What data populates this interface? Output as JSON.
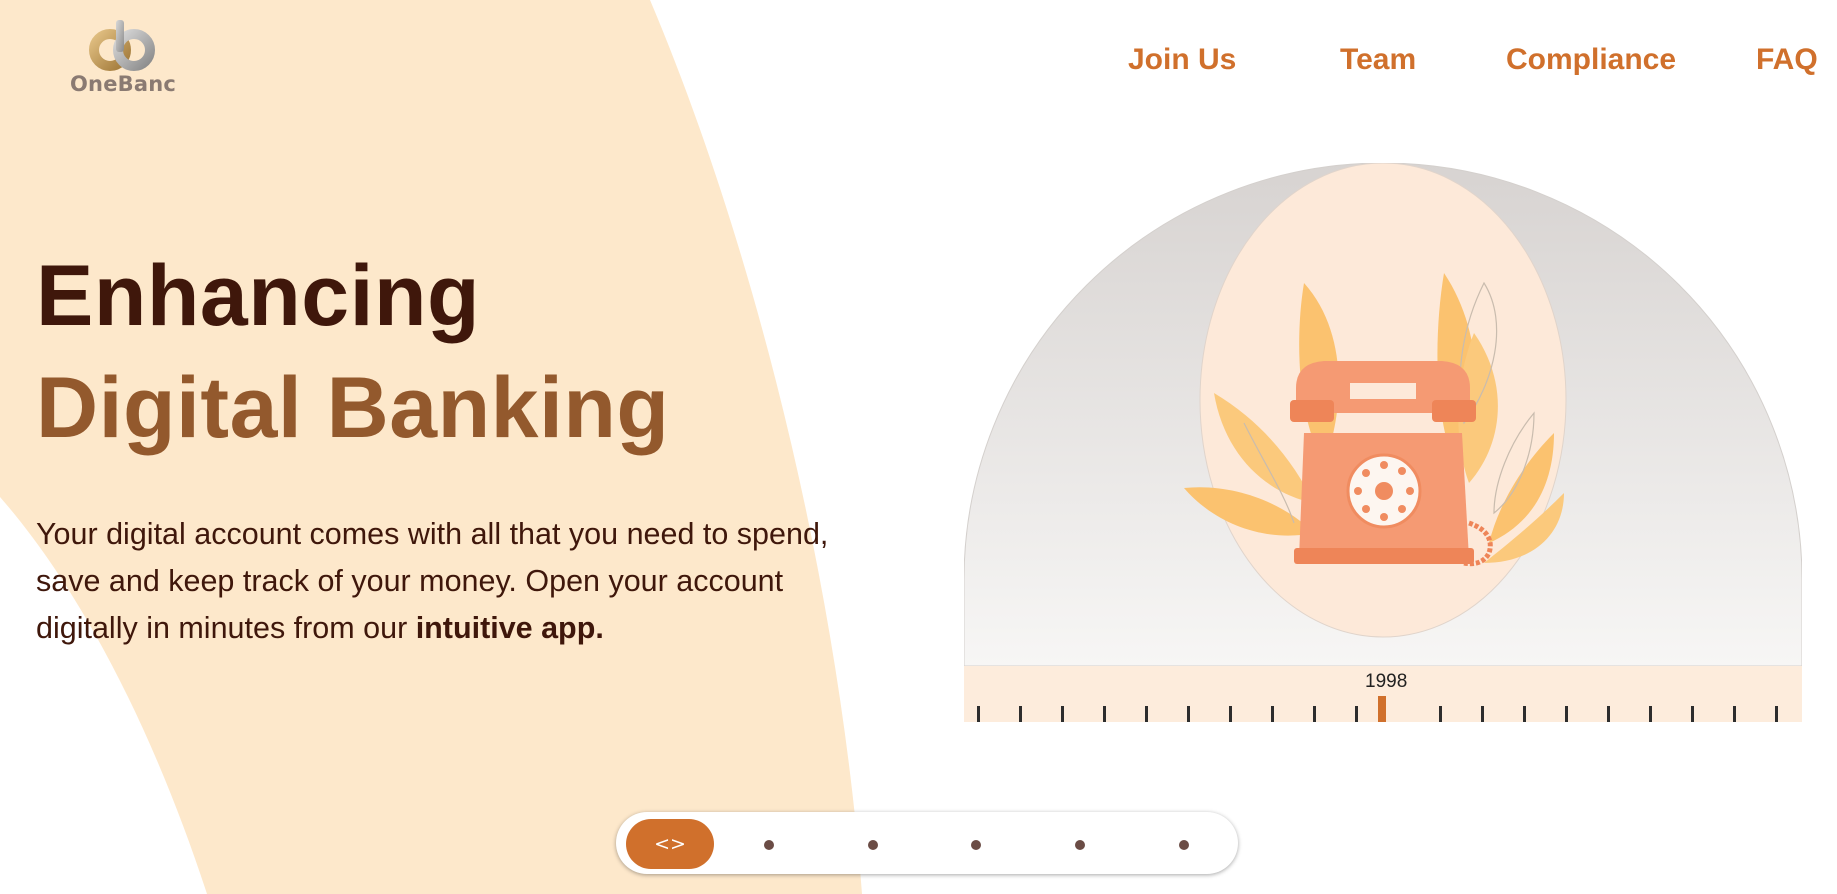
{
  "brand": {
    "name": "OneBanc",
    "logo_icon": "onebanc-logo-icon",
    "colors": {
      "accent": "#d0702c",
      "dark": "#3f170b",
      "brown": "#93592d",
      "cream": "#fde8cb"
    }
  },
  "nav": {
    "items": [
      "Join Us",
      "Team",
      "Compliance",
      "FAQ"
    ]
  },
  "hero": {
    "title_line1": "Enhancing",
    "title_line2": "Digital Banking",
    "description": "Your digital account comes with all that you need to spend, save and keep track of your money. Open your account digitally in minutes from our ",
    "description_bold": "intuitive app."
  },
  "timeline": {
    "current_year": "1998",
    "illustration": "rotary-telephone-illustration"
  },
  "pager": {
    "button_label": "<>",
    "button_icon": "code-arrows-icon",
    "dots": 5
  }
}
